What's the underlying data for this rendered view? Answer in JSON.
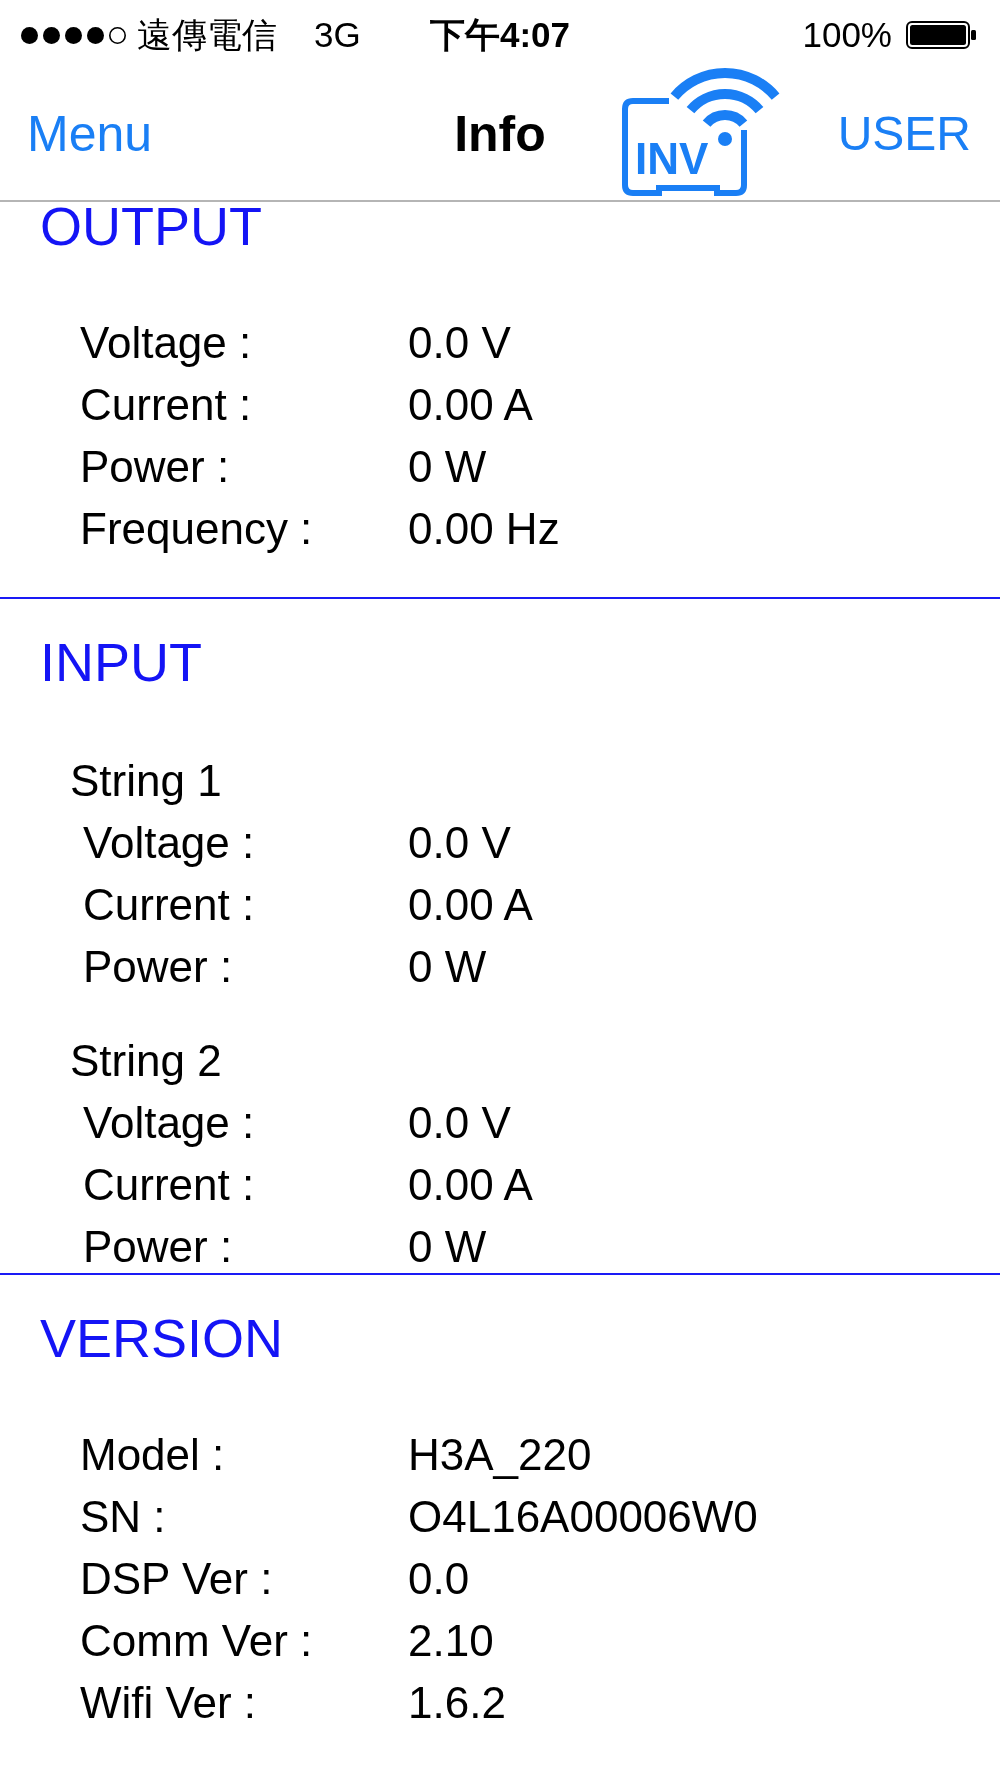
{
  "status_bar": {
    "carrier": "遠傳電信",
    "network": "3G",
    "time": "下午4:07",
    "battery": "100%"
  },
  "nav_bar": {
    "left_button": "Menu",
    "title": "Info",
    "logo_text": "INV",
    "right_button": "USER"
  },
  "sections": [
    {
      "title": "OUTPUT",
      "groups": [
        {
          "rows": [
            {
              "label": "Voltage :",
              "value": "0.0 V"
            },
            {
              "label": "Current :",
              "value": "0.00 A"
            },
            {
              "label": "Power :",
              "value": "0 W"
            },
            {
              "label": "Frequency :",
              "value": "0.00 Hz"
            }
          ]
        }
      ]
    },
    {
      "title": "INPUT",
      "groups": [
        {
          "title": "String 1",
          "rows": [
            {
              "label": "Voltage :",
              "value": "0.0 V"
            },
            {
              "label": "Current :",
              "value": "0.00 A"
            },
            {
              "label": "Power :",
              "value": "0 W"
            }
          ]
        },
        {
          "title": "String 2",
          "rows": [
            {
              "label": "Voltage :",
              "value": "0.0 V"
            },
            {
              "label": "Current :",
              "value": "0.00 A"
            },
            {
              "label": "Power :",
              "value": "0 W"
            }
          ]
        }
      ]
    },
    {
      "title": "VERSION",
      "groups": [
        {
          "rows": [
            {
              "label": "Model :",
              "value": "H3A_220"
            },
            {
              "label": "SN :",
              "value": "O4L16A00006W0"
            },
            {
              "label": "DSP Ver :",
              "value": "0.0"
            },
            {
              "label": "Comm Ver :",
              "value": "2.10"
            },
            {
              "label": "Wifi Ver :",
              "value": "1.6.2"
            }
          ]
        }
      ]
    }
  ]
}
